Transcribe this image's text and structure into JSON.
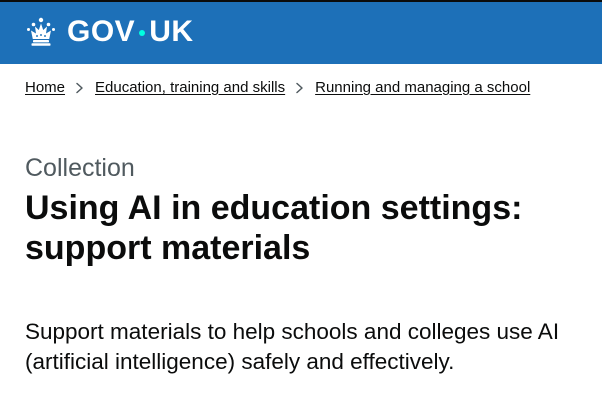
{
  "header": {
    "logo": {
      "text_left": "GOV",
      "text_right": "UK",
      "icon": "crown-icon"
    }
  },
  "breadcrumb": {
    "items": [
      {
        "label": "Home"
      },
      {
        "label": "Education, training and skills"
      },
      {
        "label": "Running and managing a school"
      }
    ],
    "separator_icon": "chevron-right-icon"
  },
  "content": {
    "caption": "Collection",
    "title": "Using AI in education settings: support materials",
    "lead": "Support materials to help schools and colleges use AI (artificial intelligence) safely and effectively."
  },
  "colors": {
    "header_bg": "#1d70b8",
    "header_border": "#0b0c0c",
    "logo_dot": "#00ffe0",
    "text": "#0b0c0c",
    "secondary_text": "#505a5f"
  }
}
